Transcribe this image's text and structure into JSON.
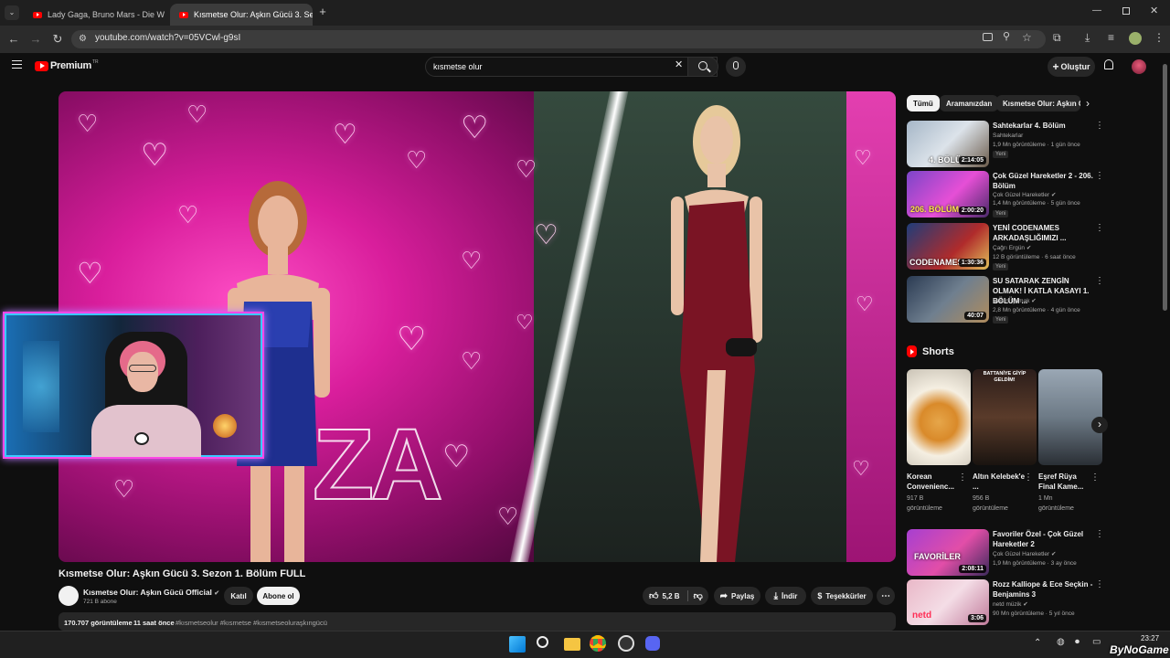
{
  "browser": {
    "tabs": [
      {
        "title": "Lady Gaga, Bruno Mars - Die W",
        "active": false
      },
      {
        "title": "Kısmetse Olur: Aşkın Gücü 3. Se",
        "active": true
      }
    ],
    "url": "youtube.com/watch?v=05VCwl-g9sI"
  },
  "youtube": {
    "logo": "Premium",
    "logo_sup": "TR",
    "search_value": "kısmetse olur",
    "create_label": "Oluştur"
  },
  "video": {
    "overlay_text": "ZA",
    "title": "Kısmetse Olur: Aşkın Gücü 3. Sezon 1. Bölüm FULL",
    "channel": "Kısmetse Olur: Aşkın Gücü Official",
    "subscribers": "721 B abone",
    "join_label": "Katıl",
    "subscribe_label": "Abone ol",
    "likes": "5,2 B",
    "share_label": "Paylaş",
    "download_label": "İndir",
    "thanks_label": "Teşekkürler",
    "views": "170.707 görüntüleme",
    "time_ago": "11 saat önce",
    "hashtags": "#kısmetseolur #kısmetse #kısmetseoluraşkıngücü"
  },
  "sidebar": {
    "chips": [
      "Tümü",
      "Aramanızdan",
      "Kısmetse Olur: Aşkın Gü"
    ],
    "videos": [
      {
        "title": "Sahtekarlar 4. Bölüm",
        "channel": "Sahtekarlar",
        "meta": "1,9 Mn görüntüleme · 1 gün önce",
        "badge": "Yeni",
        "duration": "2:14:05",
        "thumb_text": "4. BÖLÜM"
      },
      {
        "title": "Çok Güzel Hareketler 2 - 206. Bölüm",
        "channel": "Çok Güzel Hareketler",
        "meta": "1,4 Mn görüntüleme · 5 gün önce",
        "badge": "Yeni",
        "duration": "2:00:20",
        "thumb_text": "206. BÖLÜM"
      },
      {
        "title": "YENİ CODENAMES ARKADAŞLIĞIMIZI ...",
        "channel": "Çağrı Ergün",
        "meta": "12 B görüntüleme · 6 saat önce",
        "badge": "Yeni",
        "duration": "1:30:36",
        "thumb_text": "CODENAMES"
      },
      {
        "title": "SU SATARAK ZENGİN OLMAK! İ KATLA KASAYI 1. BÖLÜM ...",
        "channel": "Orkun Işıtmak",
        "meta": "2,8 Mn görüntüleme · 4 gün önce",
        "badge": "Yeni",
        "duration": "40:07",
        "thumb_text": ""
      },
      {
        "title": "Favoriler Özel - Çok Güzel Hareketler 2",
        "channel": "Çok Güzel Hareketler",
        "meta": "1,9 Mn görüntüleme · 3 ay önce",
        "badge": "",
        "duration": "2:08:11",
        "thumb_text": "FAVORİLER"
      },
      {
        "title": "Rozz Kalliope & Ece Seçkin - Benjamins 3",
        "channel": "netd müzik",
        "meta": "90 Mn görüntüleme · 5 yıl önce",
        "badge": "",
        "duration": "3:06",
        "thumb_text": "netd"
      }
    ],
    "shorts_heading": "Shorts",
    "shorts": [
      {
        "title": "Korean Convenienc...",
        "views": "917 B",
        "views_label": "görüntüleme",
        "thumb_text": ""
      },
      {
        "title": "Altın Kelebek'e ...",
        "views": "956 B",
        "views_label": "görüntüleme",
        "thumb_text": "BATTANİYE GİYİP GELDİM!"
      },
      {
        "title": "Eşref Rüya Final Kame...",
        "views": "1 Mn",
        "views_label": "görüntüleme",
        "thumb_text": ""
      }
    ]
  },
  "taskbar": {
    "time": "23:27",
    "watermark": "ByNoGame"
  },
  "colors": {
    "yt_red": "#ff0000",
    "bg": "#0f0f0f",
    "chip_bg": "#272727",
    "neon_pink": "#ff47e6",
    "neon_blue": "#39c9ff"
  }
}
